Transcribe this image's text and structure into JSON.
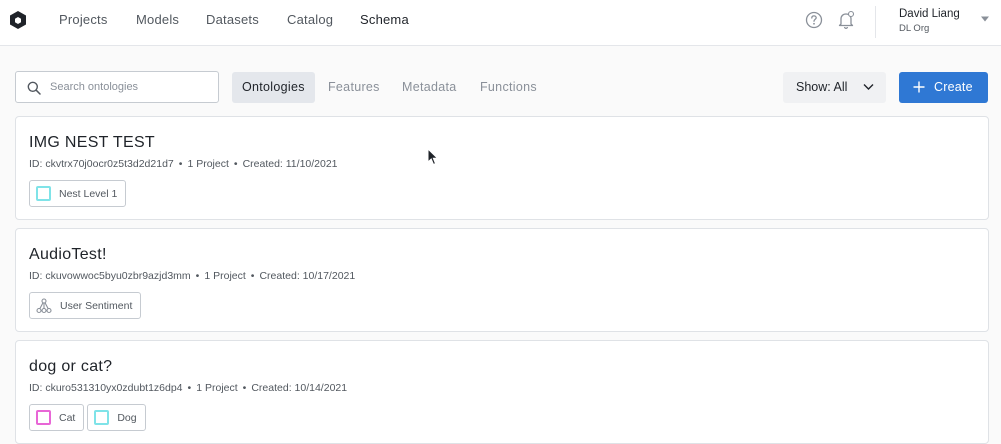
{
  "nav": {
    "items": [
      {
        "label": "Projects",
        "active": false
      },
      {
        "label": "Models",
        "active": false
      },
      {
        "label": "Datasets",
        "active": false
      },
      {
        "label": "Catalog",
        "active": false
      },
      {
        "label": "Schema",
        "active": true
      }
    ],
    "user_name": "David Liang",
    "user_org": "DL Org",
    "icons": {
      "help": "help-circle-icon",
      "notifications": "bell-icon",
      "logo": "cube-logo-icon"
    }
  },
  "toolbar": {
    "search_placeholder": "Search ontologies",
    "search_value": "",
    "tabs": [
      {
        "label": "Ontologies",
        "active": true
      },
      {
        "label": "Features",
        "active": false
      },
      {
        "label": "Metadata",
        "active": false
      },
      {
        "label": "Functions",
        "active": false
      }
    ],
    "show_label": "Show: All",
    "create_label": "Create"
  },
  "ontologies": [
    {
      "title": "IMG NEST TEST",
      "id": "ID: ckvtrx70j0ocr0z5t3d2d21d7",
      "projects": "1 Project",
      "created": "Created: 11/10/2021",
      "features": [
        {
          "label": "Nest Level 1",
          "kind": "tool",
          "color": "#7fe3e8"
        }
      ]
    },
    {
      "title": "AudioTest!",
      "id": "ID: ckuvowwoc5byu0zbr9azjd3mm",
      "projects": "1 Project",
      "created": "Created: 10/17/2021",
      "features": [
        {
          "label": "User Sentiment",
          "kind": "classification",
          "color": "#8a9099"
        }
      ]
    },
    {
      "title": "dog or cat?",
      "id": "ID: ckuro531310yx0zdubt1z6dp4",
      "projects": "1 Project",
      "created": "Created: 10/14/2021",
      "features": [
        {
          "label": "Cat",
          "kind": "tool",
          "color": "#e866d6"
        },
        {
          "label": "Dog",
          "kind": "tool",
          "color": "#7fe3e8"
        }
      ]
    }
  ],
  "colors": {
    "accent": "#2f78d4",
    "active_tab_bg": "#e4e7ec"
  }
}
